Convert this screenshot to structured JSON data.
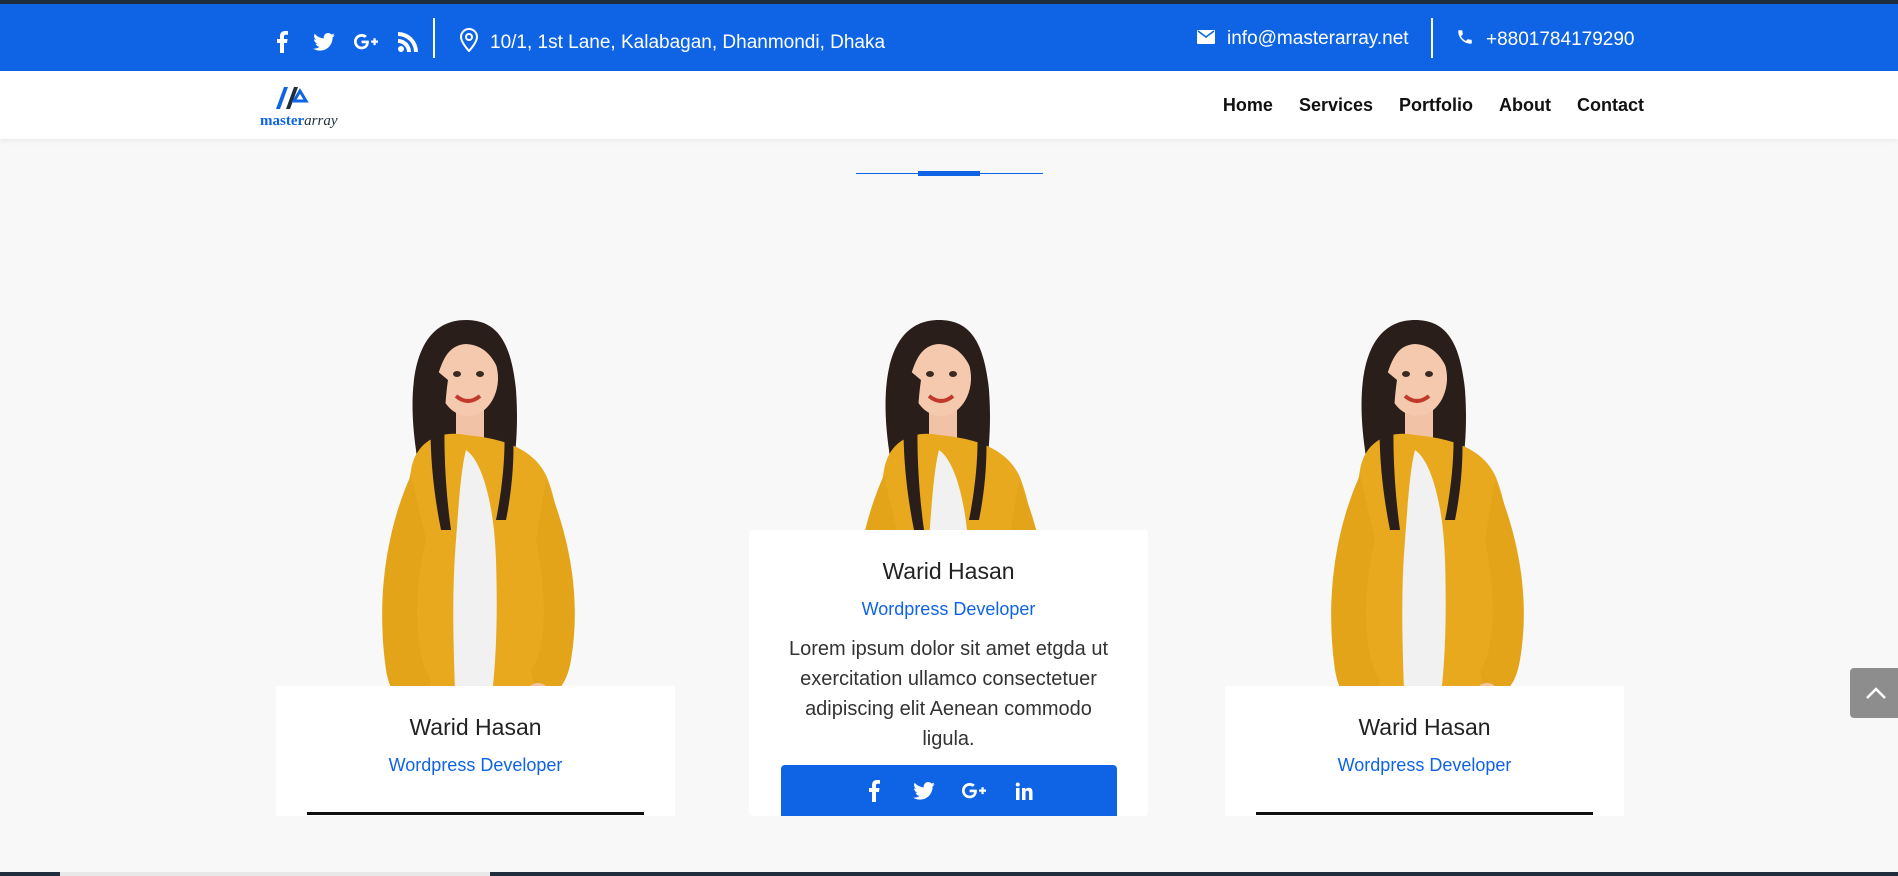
{
  "topbar": {
    "social_icons": [
      "facebook-icon",
      "twitter-icon",
      "google-plus-icon",
      "rss-icon"
    ],
    "address": "10/1, 1st Lane, Kalabagan, Dhanmondi, Dhaka",
    "email": "info@masterarray.net",
    "phone": "+8801784179290"
  },
  "brand": {
    "logo_primary": "master",
    "logo_secondary": "array"
  },
  "nav": {
    "items": [
      "Home",
      "Services",
      "Portfolio",
      "About",
      "Contact"
    ]
  },
  "team": [
    {
      "name": "Warid Hasan",
      "role": "Wordpress Developer"
    },
    {
      "name": "Warid Hasan",
      "role": "Wordpress Developer",
      "description": "Lorem ipsum dolor sit amet etgda ut exercitation ullamco consectetuer adipiscing elit Aenean commodo ligula.",
      "social_icons": [
        "facebook-icon",
        "twitter-icon",
        "google-plus-icon",
        "linkedin-icon"
      ]
    },
    {
      "name": "Warid Hasan",
      "role": "Wordpress Developer"
    }
  ],
  "colors": {
    "brand_blue": "#0f64e6",
    "dark": "#1f2d3d",
    "scroll_button": "#8d8d8d"
  }
}
